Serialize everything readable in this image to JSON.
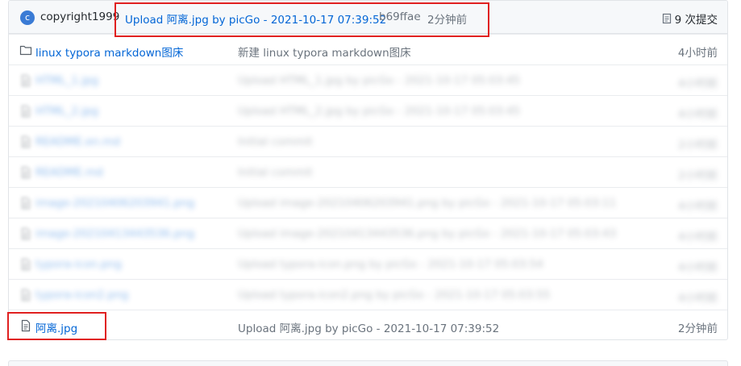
{
  "commit": {
    "avatar_letter": "c",
    "author": "copyright1999",
    "message": "Upload 阿离.jpg by picGo - 2021-10-17 07:39:52",
    "sha": "b69ffae",
    "age": "2分钟前",
    "commits_count": "9 次提交",
    "avatar_color": "#3a7bd5"
  },
  "rows": [
    {
      "icon": "folder-icon",
      "name": "linux typora markdown图床",
      "message": "新建 linux typora markdown图床",
      "age": "4小时前"
    },
    {
      "icon": "file-icon",
      "name": "HTML_1.jpg",
      "message": "Upload HTML_1.jpg by picGo - 2021-10-17 05:03:45",
      "age": "4小时前"
    },
    {
      "icon": "file-icon",
      "name": "HTML_2.jpg",
      "message": "Upload HTML_2.jpg by picGo - 2021-10-17 05:03:45",
      "age": "4小时前"
    },
    {
      "icon": "file-icon",
      "name": "README.en.md",
      "message": "Initial commit",
      "age": "2小时前"
    },
    {
      "icon": "file-icon",
      "name": "README.md",
      "message": "Initial commit",
      "age": "2小时前"
    },
    {
      "icon": "file-icon",
      "name": "image-20210406203941.png",
      "message": "Upload image-20210406203941.png by picGo - 2021-10-17 05:03:11",
      "age": "4小时前"
    },
    {
      "icon": "file-icon",
      "name": "image-20210413443536.png",
      "message": "Upload image-20210413443536.png by picGo - 2021-10-17 05:03:43",
      "age": "4小时前"
    },
    {
      "icon": "file-icon",
      "name": "typora-icon.png",
      "message": "Upload typora-icon.png by picGo - 2021-10-17 05:03:54",
      "age": "4小时前"
    },
    {
      "icon": "file-icon",
      "name": "typora-icon2.png",
      "message": "Upload typora-icon2.png by picGo - 2021-10-17 05:03:55",
      "age": "4小时前"
    },
    {
      "icon": "file-icon",
      "name": "阿离.jpg",
      "message": "Upload 阿离.jpg by picGo - 2021-10-17 07:39:52",
      "age": "2分钟前"
    }
  ],
  "highlight_color": "#e02020"
}
